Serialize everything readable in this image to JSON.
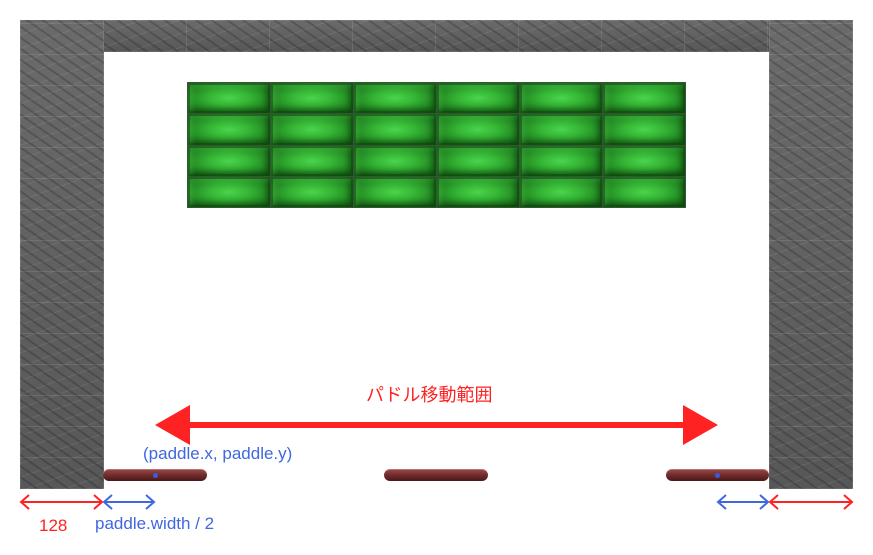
{
  "annotations": {
    "movement_range": "パドル移動範囲",
    "paddle_position": "(paddle.x, paddle.y)",
    "paddle_half_width": "paddle.width / 2",
    "wall_width": "128"
  },
  "bricks": {
    "rows": 4,
    "columns": 6
  },
  "colors": {
    "range_arrow": "#ff2222",
    "width_arrow": "#3f67e0",
    "brick": "#35b535",
    "paddle": "#6e2a2a",
    "wall": "#5f5f5f"
  }
}
